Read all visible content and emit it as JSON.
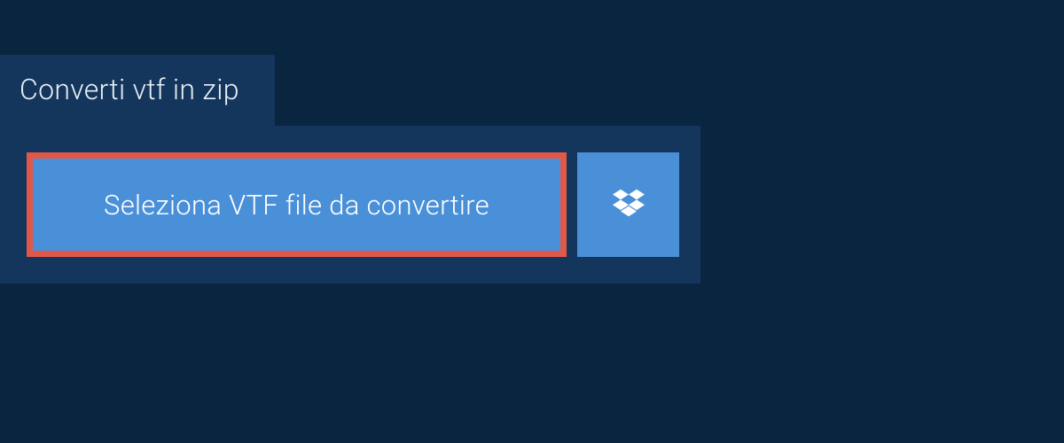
{
  "tab": {
    "label": "Converti vtf in zip"
  },
  "actions": {
    "select_file_label": "Seleziona VTF file da convertire"
  },
  "colors": {
    "background": "#0a2540",
    "panel": "#14365c",
    "button": "#4a90d9",
    "highlight_border": "#e15848",
    "text": "#ffffff"
  }
}
